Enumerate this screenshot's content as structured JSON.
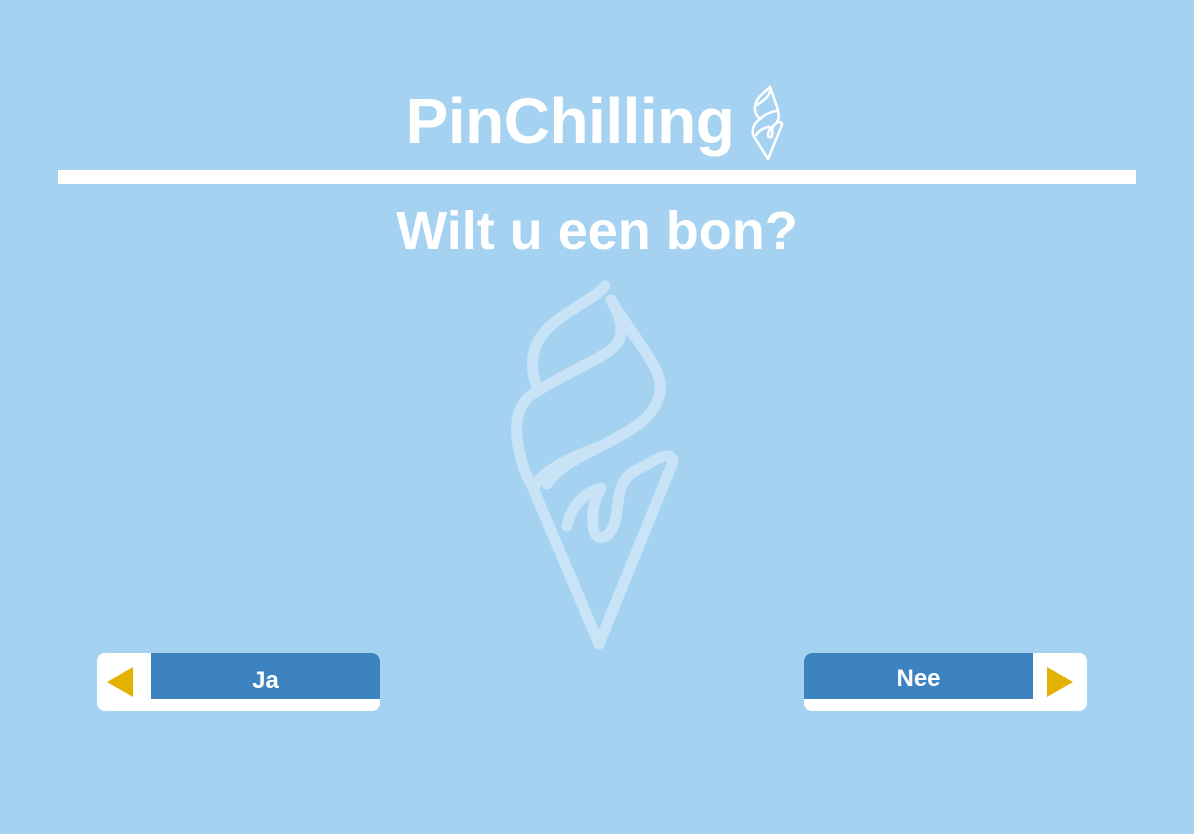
{
  "header": {
    "app_name": "PinChilling",
    "logo_icon": "ice-cream-cone-icon"
  },
  "prompt": {
    "question": "Wilt u een bon?"
  },
  "watermark": {
    "icon": "ice-cream-cone-icon"
  },
  "buttons": {
    "yes_label": "Ja",
    "yes_icon": "triangle-left-icon",
    "no_label": "Nee",
    "no_icon": "triangle-right-icon"
  },
  "colors": {
    "background": "#a6d2f1",
    "button_bar": "#3d83bf",
    "arrow": "#e3b100",
    "foreground": "#ffffff"
  }
}
